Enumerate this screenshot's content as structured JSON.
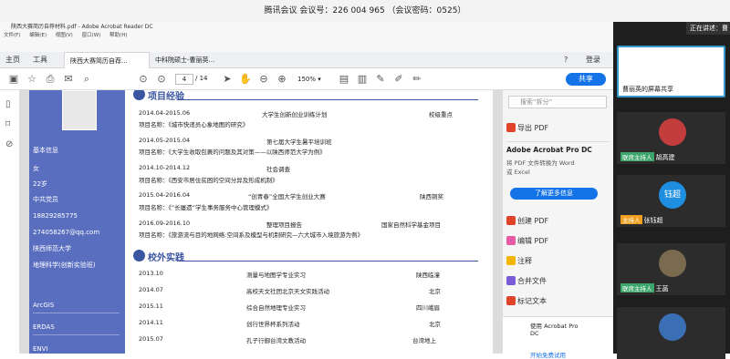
{
  "meeting": {
    "title": "腾讯会议 会议号：226 004 965 （会议密码：0525）"
  },
  "window": {
    "title": "陕西大赛简历自荐材料.pdf - Adobe Acrobat Reader DC",
    "menu": [
      "文件(F)",
      "编辑(E)",
      "视图(V)",
      "窗口(W)",
      "帮助(H)"
    ]
  },
  "tabs": {
    "home": "主页",
    "tools": "工具",
    "doc1": "陕西大赛简历自荐...",
    "doc2": "中科院硕士-曹丽英..."
  },
  "toolbar": {
    "page_current": "4",
    "page_total": "/ 14",
    "zoom": "150%",
    "share": "共享",
    "signin": "登录"
  },
  "resume": {
    "side": {
      "basic": "基本信息",
      "gender": "女",
      "age": "22岁",
      "party": "中共党员",
      "phone": "18829285775",
      "email": "274058267@qq.com",
      "school": "陕西师范大学",
      "major": "地理科学(创新实验班)",
      "sk1": "ArcGIS",
      "sk2": "ERDAS",
      "sk3": "ENVI"
    },
    "sec1": "项目经验",
    "projects": [
      {
        "date": "2014.04-2015.06",
        "title": "大学生创新创业训练计划",
        "tag": "校级重点",
        "name": "项目名称：《城市快递员心象地图的研究》"
      },
      {
        "date": "2014.05-2015.04",
        "title": "第七届大学生暑平培训班",
        "tag": "",
        "name": "项目名称：《大学生收取包裹的问题及其对策——以陕西师范大学为例》"
      },
      {
        "date": "2014.10-2014.12",
        "title": "社会调查",
        "tag": "",
        "name": "项目名称：《西安市居住贫困的空间分异及形成机制》"
      },
      {
        "date": "2015.04-2016.04",
        "title": "“创青春”全国大学生创业大赛",
        "tag": "陕西铜奖",
        "name": "项目名称：《“长屡遗”学生事务服务中心管理模式》"
      },
      {
        "date": "2016.09-2016.10",
        "title": "整理项目报告",
        "tag": "国家自然科学基金项目",
        "name": "项目名称：《旅游流与目的地网络:空间系及模型与机制研究—六大城市入境旅游为例》"
      }
    ],
    "sec2": "校外实践",
    "practice": [
      {
        "date": "2013.10",
        "title": "测量与地图学专业实习",
        "place": "陕西临潼"
      },
      {
        "date": "2014.07",
        "title": "高校天文社团北京天文实践活动",
        "place": "北京"
      },
      {
        "date": "2015.11",
        "title": "综合自然地理专业实习",
        "place": "四川峨眉"
      },
      {
        "date": "2014.11",
        "title": "创行世界杯系列活动",
        "place": "北京"
      },
      {
        "date": "2015.07",
        "title": "孔子行御台湾文教活动",
        "place": "台湾地上"
      }
    ]
  },
  "right_panel": {
    "search": "搜索“拆分”",
    "export": "导出 PDF",
    "promo_title": "Adobe Acrobat Pro DC",
    "promo_text": "将 PDF 文件转换为 Word 或 Excel",
    "learn": "了解更多信息",
    "items": [
      "创建 PDF",
      "编辑 PDF",
      "注释",
      "合并文件",
      "标记文本"
    ],
    "footer1": "使用 Acrobat Pro DC",
    "footer2": "开始免费试用"
  },
  "video": {
    "sharing": "正在讲述：曹",
    "tiles": [
      {
        "host": "",
        "name": "曹丽英的屏幕共享"
      },
      {
        "host": "联席主持人",
        "name": "胡高建"
      },
      {
        "host": "主持人",
        "name": "张钰超",
        "initial": "钰超"
      },
      {
        "host": "联席主持人",
        "name": "王菡"
      },
      {
        "host": "",
        "name": ""
      }
    ]
  },
  "colors": {
    "accent": "#3b55a3",
    "side": "#5a6ec0",
    "share_btn": "#1473e6"
  }
}
